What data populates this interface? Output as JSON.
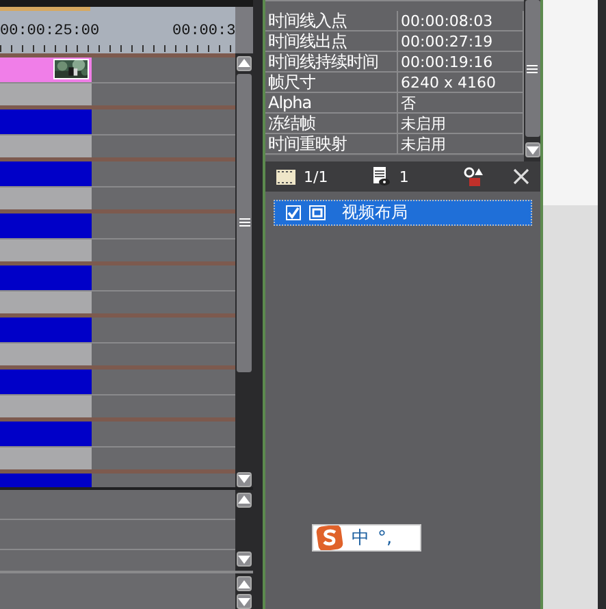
{
  "timeline": {
    "ruler_labels": [
      "00:00:25:00",
      "00:00:3"
    ],
    "tracks": [
      {
        "color": "#f07ee8",
        "thumbnail": true
      },
      {
        "color": "#0000c8",
        "thumbnail": false
      },
      {
        "color": "#0000c8",
        "thumbnail": false
      },
      {
        "color": "#0000c8",
        "thumbnail": false
      },
      {
        "color": "#0000c8",
        "thumbnail": false
      },
      {
        "color": "#0000c8",
        "thumbnail": false
      },
      {
        "color": "#0000c8",
        "thumbnail": false
      },
      {
        "color": "#0000c8",
        "thumbnail": false
      },
      {
        "color": "#0000c8",
        "thumbnail": false
      }
    ]
  },
  "properties": {
    "rows": [
      {
        "label": "时间线入点",
        "value": "00:00:08:03"
      },
      {
        "label": "时间线出点",
        "value": "00:00:27:19"
      },
      {
        "label": "时间线持续时间",
        "value": "00:00:19:16"
      },
      {
        "label": "帧尺寸",
        "value": "6240 x 4160"
      },
      {
        "label": "Alpha",
        "value": "否"
      },
      {
        "label": "冻结帧",
        "value": "未启用"
      },
      {
        "label": "时间重映射",
        "value": "未启用"
      }
    ]
  },
  "layers_toolbar": {
    "page": "1/1",
    "count": "1"
  },
  "layers": [
    {
      "label": "视频布局",
      "checked": true,
      "selected": true
    }
  ],
  "ime_bar": {
    "mode": "中",
    "punctuation": "°,"
  }
}
